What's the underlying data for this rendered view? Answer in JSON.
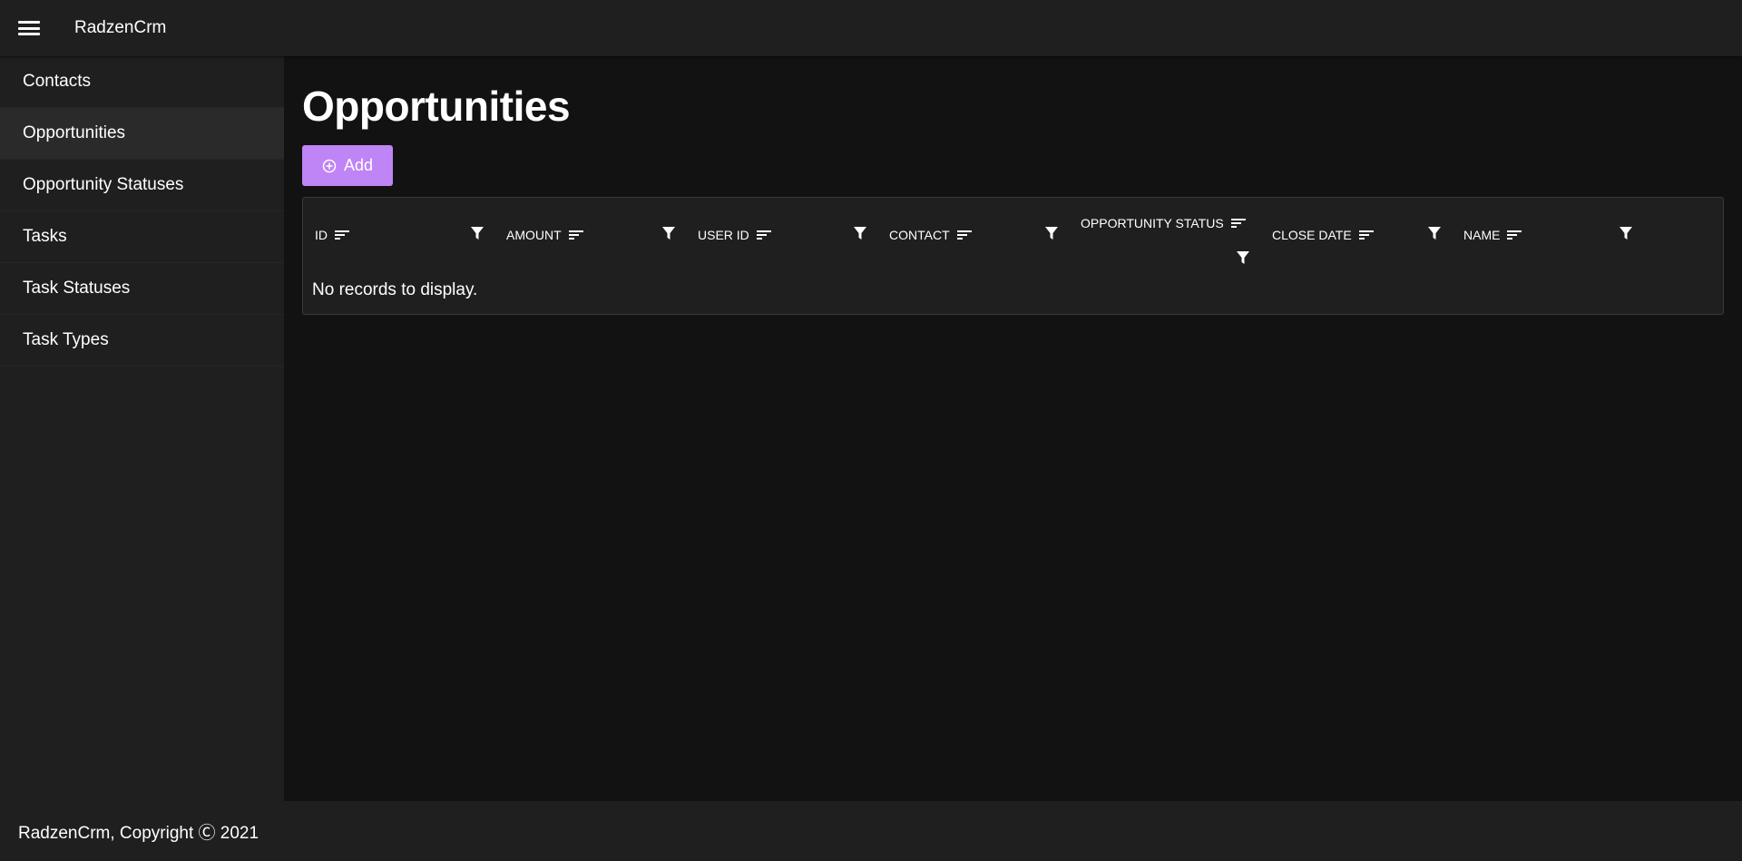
{
  "header": {
    "app_title": "RadzenCrm"
  },
  "sidebar": {
    "items": [
      {
        "label": "Contacts",
        "active": false
      },
      {
        "label": "Opportunities",
        "active": true
      },
      {
        "label": "Opportunity Statuses",
        "active": false
      },
      {
        "label": "Tasks",
        "active": false
      },
      {
        "label": "Task Statuses",
        "active": false
      },
      {
        "label": "Task Types",
        "active": false
      }
    ]
  },
  "main": {
    "title": "Opportunities",
    "add_button_label": "Add",
    "accent_color": "#bf84f5",
    "grid": {
      "columns": [
        {
          "label": "ID"
        },
        {
          "label": "AMOUNT"
        },
        {
          "label": "USER ID"
        },
        {
          "label": "CONTACT"
        },
        {
          "label": "OPPORTUNITY STATUS"
        },
        {
          "label": "CLOSE DATE"
        },
        {
          "label": "NAME"
        }
      ],
      "empty_message": "No records to display."
    }
  },
  "footer": {
    "text": "RadzenCrm, Copyright Ⓒ 2021"
  }
}
